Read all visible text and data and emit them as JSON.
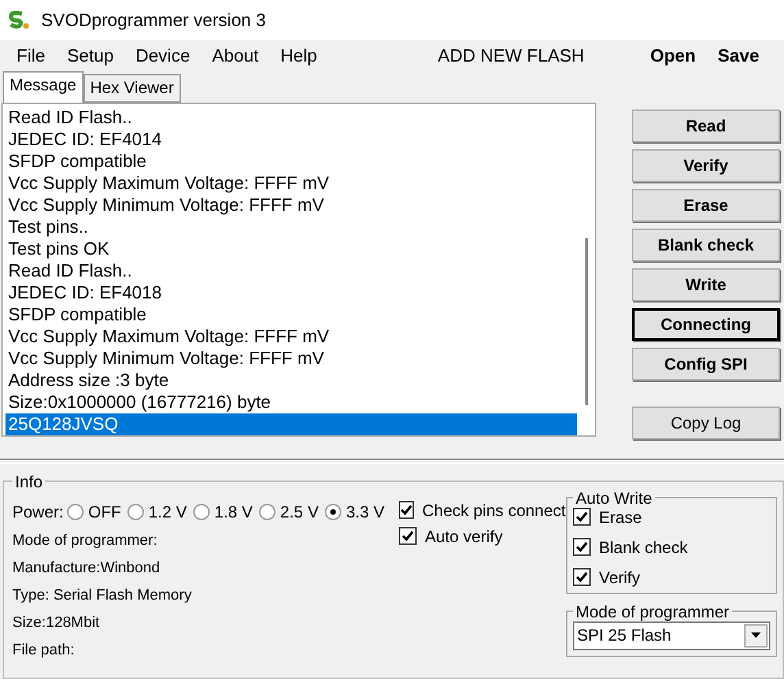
{
  "window": {
    "title": "SVODprogrammer version 3"
  },
  "menu": [
    {
      "label": "File"
    },
    {
      "label": "Setup"
    },
    {
      "label": "Device"
    },
    {
      "label": "About"
    },
    {
      "label": "Help"
    }
  ],
  "menu_center": "ADD NEW FLASH",
  "menu_right": [
    {
      "label": "Open"
    },
    {
      "label": "Save"
    }
  ],
  "tabs": [
    {
      "label": "Message",
      "selected": true
    },
    {
      "label": "Hex Viewer",
      "selected": false
    }
  ],
  "log": [
    {
      "text": "Read ID Flash..",
      "selected": false
    },
    {
      "text": "JEDEC ID: EF4014",
      "selected": false
    },
    {
      "text": "SFDP compatible",
      "selected": false
    },
    {
      "text": "Vcc Supply Maximum Voltage: FFFF mV",
      "selected": false
    },
    {
      "text": "Vcc Supply Minimum Voltage: FFFF mV",
      "selected": false
    },
    {
      "text": "Test pins..",
      "selected": false
    },
    {
      "text": "Test pins OK",
      "selected": false
    },
    {
      "text": "Read ID Flash..",
      "selected": false
    },
    {
      "text": "JEDEC ID: EF4018",
      "selected": false
    },
    {
      "text": "SFDP compatible",
      "selected": false
    },
    {
      "text": "Vcc Supply Maximum Voltage: FFFF mV",
      "selected": false
    },
    {
      "text": "Vcc Supply Minimum Voltage: FFFF mV",
      "selected": false
    },
    {
      "text": "Address size :3 byte",
      "selected": false
    },
    {
      "text": "Size:0x1000000 (16777216) byte",
      "selected": false
    },
    {
      "text": "25Q128JVSQ",
      "selected": true
    }
  ],
  "buttons": [
    {
      "label": "Read",
      "kind": "bold",
      "focused": false
    },
    {
      "label": "Verify",
      "kind": "bold",
      "focused": false
    },
    {
      "label": "Erase",
      "kind": "bold",
      "focused": false
    },
    {
      "label": "Blank check",
      "kind": "bold",
      "focused": false
    },
    {
      "label": "Write",
      "kind": "bold",
      "focused": false
    },
    {
      "label": "Connecting",
      "kind": "bold",
      "focused": true
    },
    {
      "label": "Config SPI",
      "kind": "bold",
      "focused": false
    }
  ],
  "copy_button": {
    "label": "Copy Log"
  },
  "info": {
    "title": "Info",
    "power_label": "Power:",
    "power": [
      {
        "label": "OFF",
        "selected": false
      },
      {
        "label": "1.2 V",
        "selected": false
      },
      {
        "label": "1.8 V",
        "selected": false
      },
      {
        "label": "2.5 V",
        "selected": false
      },
      {
        "label": "3.3 V",
        "selected": true
      }
    ],
    "details": [
      "Mode of programmer:",
      "Manufacture:Winbond",
      "Type: Serial Flash Memory",
      "Size:128Mbit",
      "File path:"
    ],
    "options": [
      {
        "label": "Check pins connect",
        "checked": true
      },
      {
        "label": "Auto verify",
        "checked": true
      }
    ],
    "auto_write": {
      "title": "Auto Write",
      "options": [
        {
          "label": "Erase",
          "checked": true
        },
        {
          "label": "Blank check",
          "checked": true
        },
        {
          "label": "Verify",
          "checked": true
        }
      ]
    },
    "mode": {
      "title": "Mode of programmer",
      "value": "SPI 25 Flash"
    }
  }
}
